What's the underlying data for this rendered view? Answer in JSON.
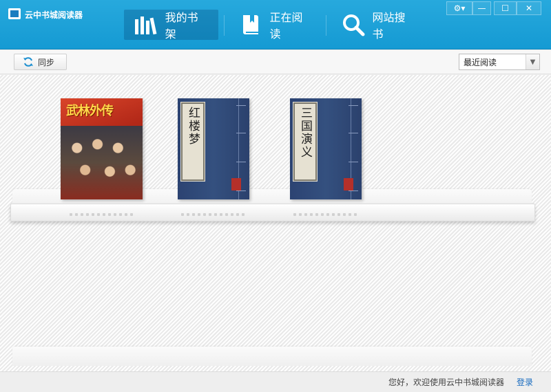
{
  "app": {
    "title": "云中书城阅读器",
    "logo_icon": "app-logo-icon",
    "accent": "#1c9fd8"
  },
  "nav": {
    "tabs": [
      {
        "label": "我的书架",
        "icon": "bookshelf-icon",
        "active": true
      },
      {
        "label": "正在阅读",
        "icon": "open-book-icon",
        "active": false
      },
      {
        "label": "网站搜书",
        "icon": "search-icon",
        "active": false
      }
    ]
  },
  "window_controls": {
    "settings": "⚙▾",
    "minimize": "—",
    "maximize": "☐",
    "close": "✕"
  },
  "toolbar": {
    "sync_label": "同步",
    "sort_value": "最近阅读"
  },
  "books": [
    {
      "title": "武林外传",
      "style": "photo-cover"
    },
    {
      "title": "红楼梦",
      "style": "classic-blue"
    },
    {
      "title": "三国演义",
      "style": "classic-blue"
    }
  ],
  "status": {
    "welcome": "您好，欢迎使用云中书城阅读器",
    "login": "登录"
  }
}
